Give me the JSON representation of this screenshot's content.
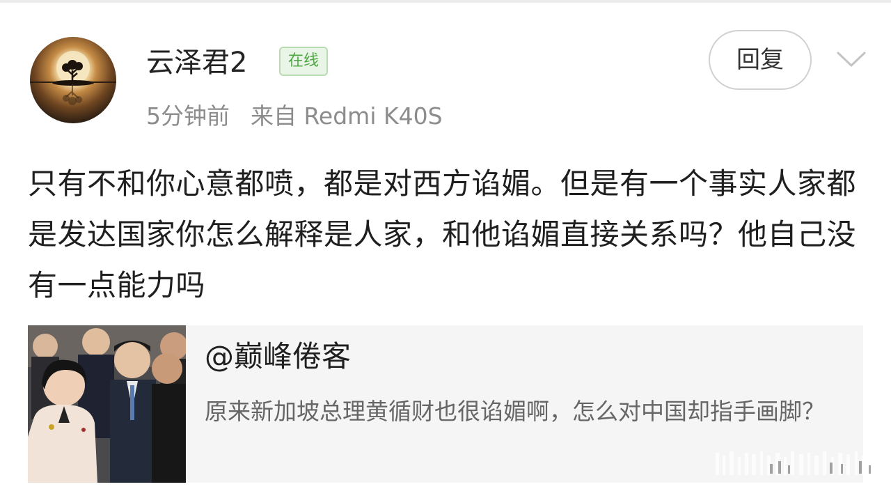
{
  "comment_header": {
    "username": "云泽君2",
    "online_badge": "在线",
    "time": "5分钟前",
    "source": "来自 Redmi K40S",
    "reply_label": "回复"
  },
  "comment": {
    "text": "只有不和你心意都喷，都是对西方谄媚。但是有一个事实人家都是发达国家你怎么解释是人家，和他谄媚直接关系吗？他自己没有一点能力吗"
  },
  "quote": {
    "author": "@巅峰倦客",
    "text": "原来新加坡总理黄循财也很谄媚啊，怎么对中国却指手画脚？"
  },
  "icons": {
    "avatar": "moon-tree-reflection-image",
    "menu": "chevron-down-icon"
  },
  "colors": {
    "online_green": "#4fa845",
    "meta_gray": "#8c8c8c",
    "card_bg": "#f5f5f5"
  }
}
